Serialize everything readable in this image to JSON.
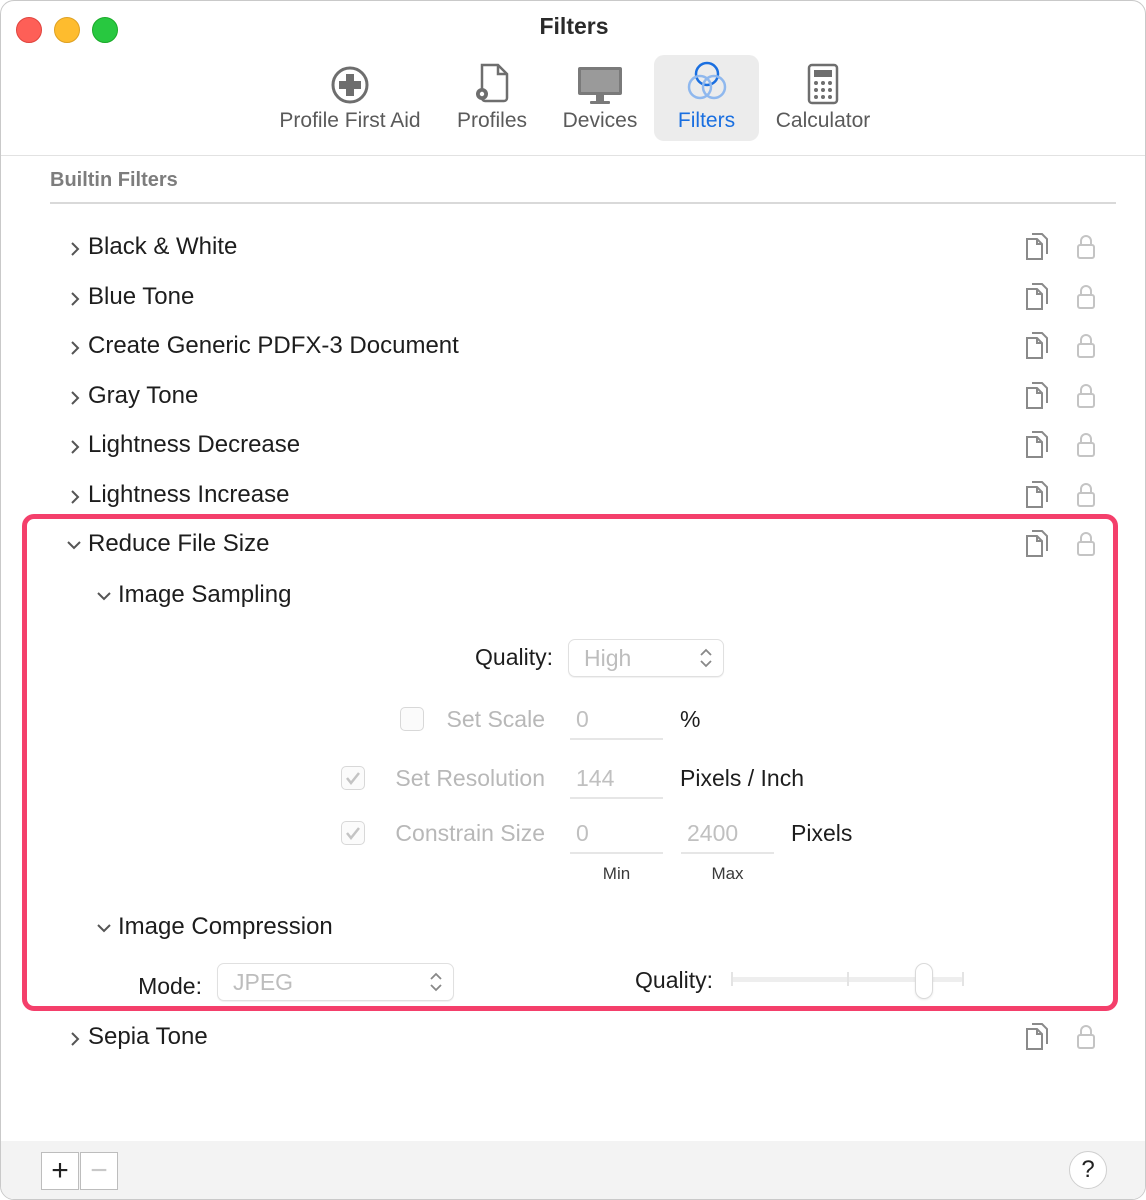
{
  "window": {
    "title": "Filters"
  },
  "toolbar": {
    "items": [
      {
        "label": "Profile First Aid",
        "icon": "first-aid-icon",
        "active": false
      },
      {
        "label": "Profiles",
        "icon": "profiles-icon",
        "active": false
      },
      {
        "label": "Devices",
        "icon": "display-icon",
        "active": false
      },
      {
        "label": "Filters",
        "icon": "filters-icon",
        "active": true
      },
      {
        "label": "Calculator",
        "icon": "calculator-icon",
        "active": false
      }
    ],
    "accent_color": "#1a6fe0"
  },
  "section": {
    "title": "Builtin Filters"
  },
  "filters": [
    {
      "label": "Black & White",
      "expanded": false
    },
    {
      "label": "Blue Tone",
      "expanded": false
    },
    {
      "label": "Create Generic PDFX-3 Document",
      "expanded": false
    },
    {
      "label": "Gray Tone",
      "expanded": false
    },
    {
      "label": "Lightness Decrease",
      "expanded": false
    },
    {
      "label": "Lightness Increase",
      "expanded": false
    },
    {
      "label": "Reduce File Size",
      "expanded": true
    },
    {
      "label": "Sepia Tone",
      "expanded": false
    }
  ],
  "reduce_file_size": {
    "highlight_color": "#f43f6b",
    "image_sampling": {
      "title": "Image Sampling",
      "quality_label": "Quality:",
      "quality_value": "High",
      "set_scale": {
        "label": "Set Scale",
        "checked": false,
        "value": "0",
        "unit": "%"
      },
      "set_resolution": {
        "label": "Set Resolution",
        "checked": true,
        "value": "144",
        "unit": "Pixels / Inch"
      },
      "constrain_size": {
        "label": "Constrain Size",
        "checked": true,
        "min_value": "0",
        "max_value": "2400",
        "unit": "Pixels",
        "min_label": "Min",
        "max_label": "Max"
      }
    },
    "image_compression": {
      "title": "Image Compression",
      "mode_label": "Mode:",
      "mode_value": "JPEG",
      "quality_label": "Quality:",
      "quality_level": 0.83
    }
  },
  "bottom": {
    "add_label": "+",
    "remove_label": "−",
    "help_label": "?"
  }
}
